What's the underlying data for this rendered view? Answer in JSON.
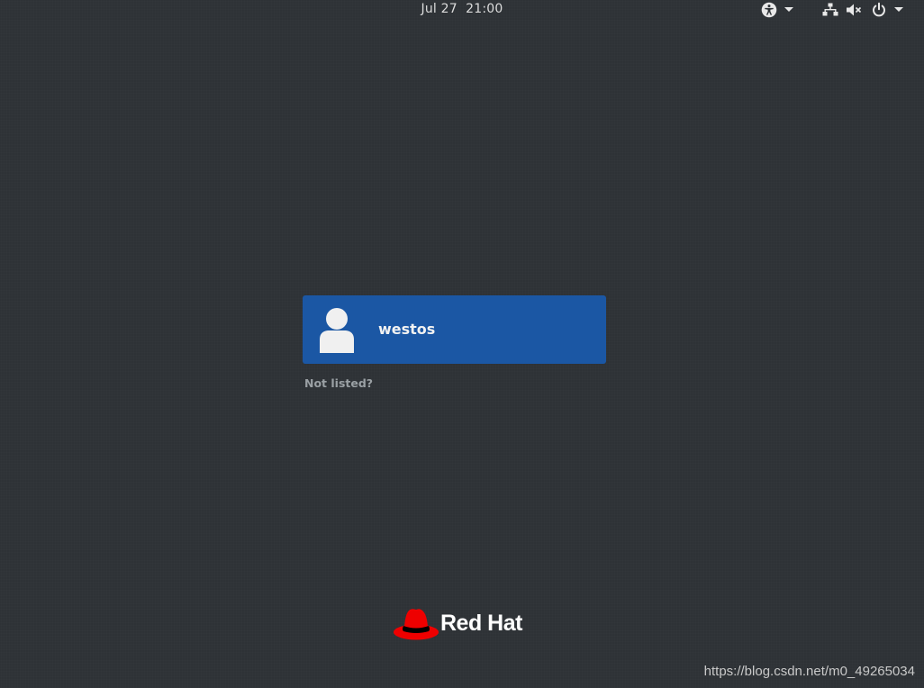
{
  "topbar": {
    "clock": "Jul 27  21:00",
    "icons": [
      "accessibility-icon",
      "dropdown-arrow-icon",
      "network-wired-icon",
      "volume-muted-icon",
      "power-icon",
      "dropdown-arrow-icon"
    ]
  },
  "users": {
    "items": [
      {
        "name": "westos",
        "avatar": "user-avatar-icon"
      }
    ],
    "not_listed": "Not listed?"
  },
  "branding": {
    "logo_text": "Red Hat",
    "logo_color": "#ee0000"
  },
  "watermark": "https://blog.csdn.net/m0_49265034",
  "colors": {
    "background": "#2e3236",
    "user_card": "#1b57a4"
  }
}
